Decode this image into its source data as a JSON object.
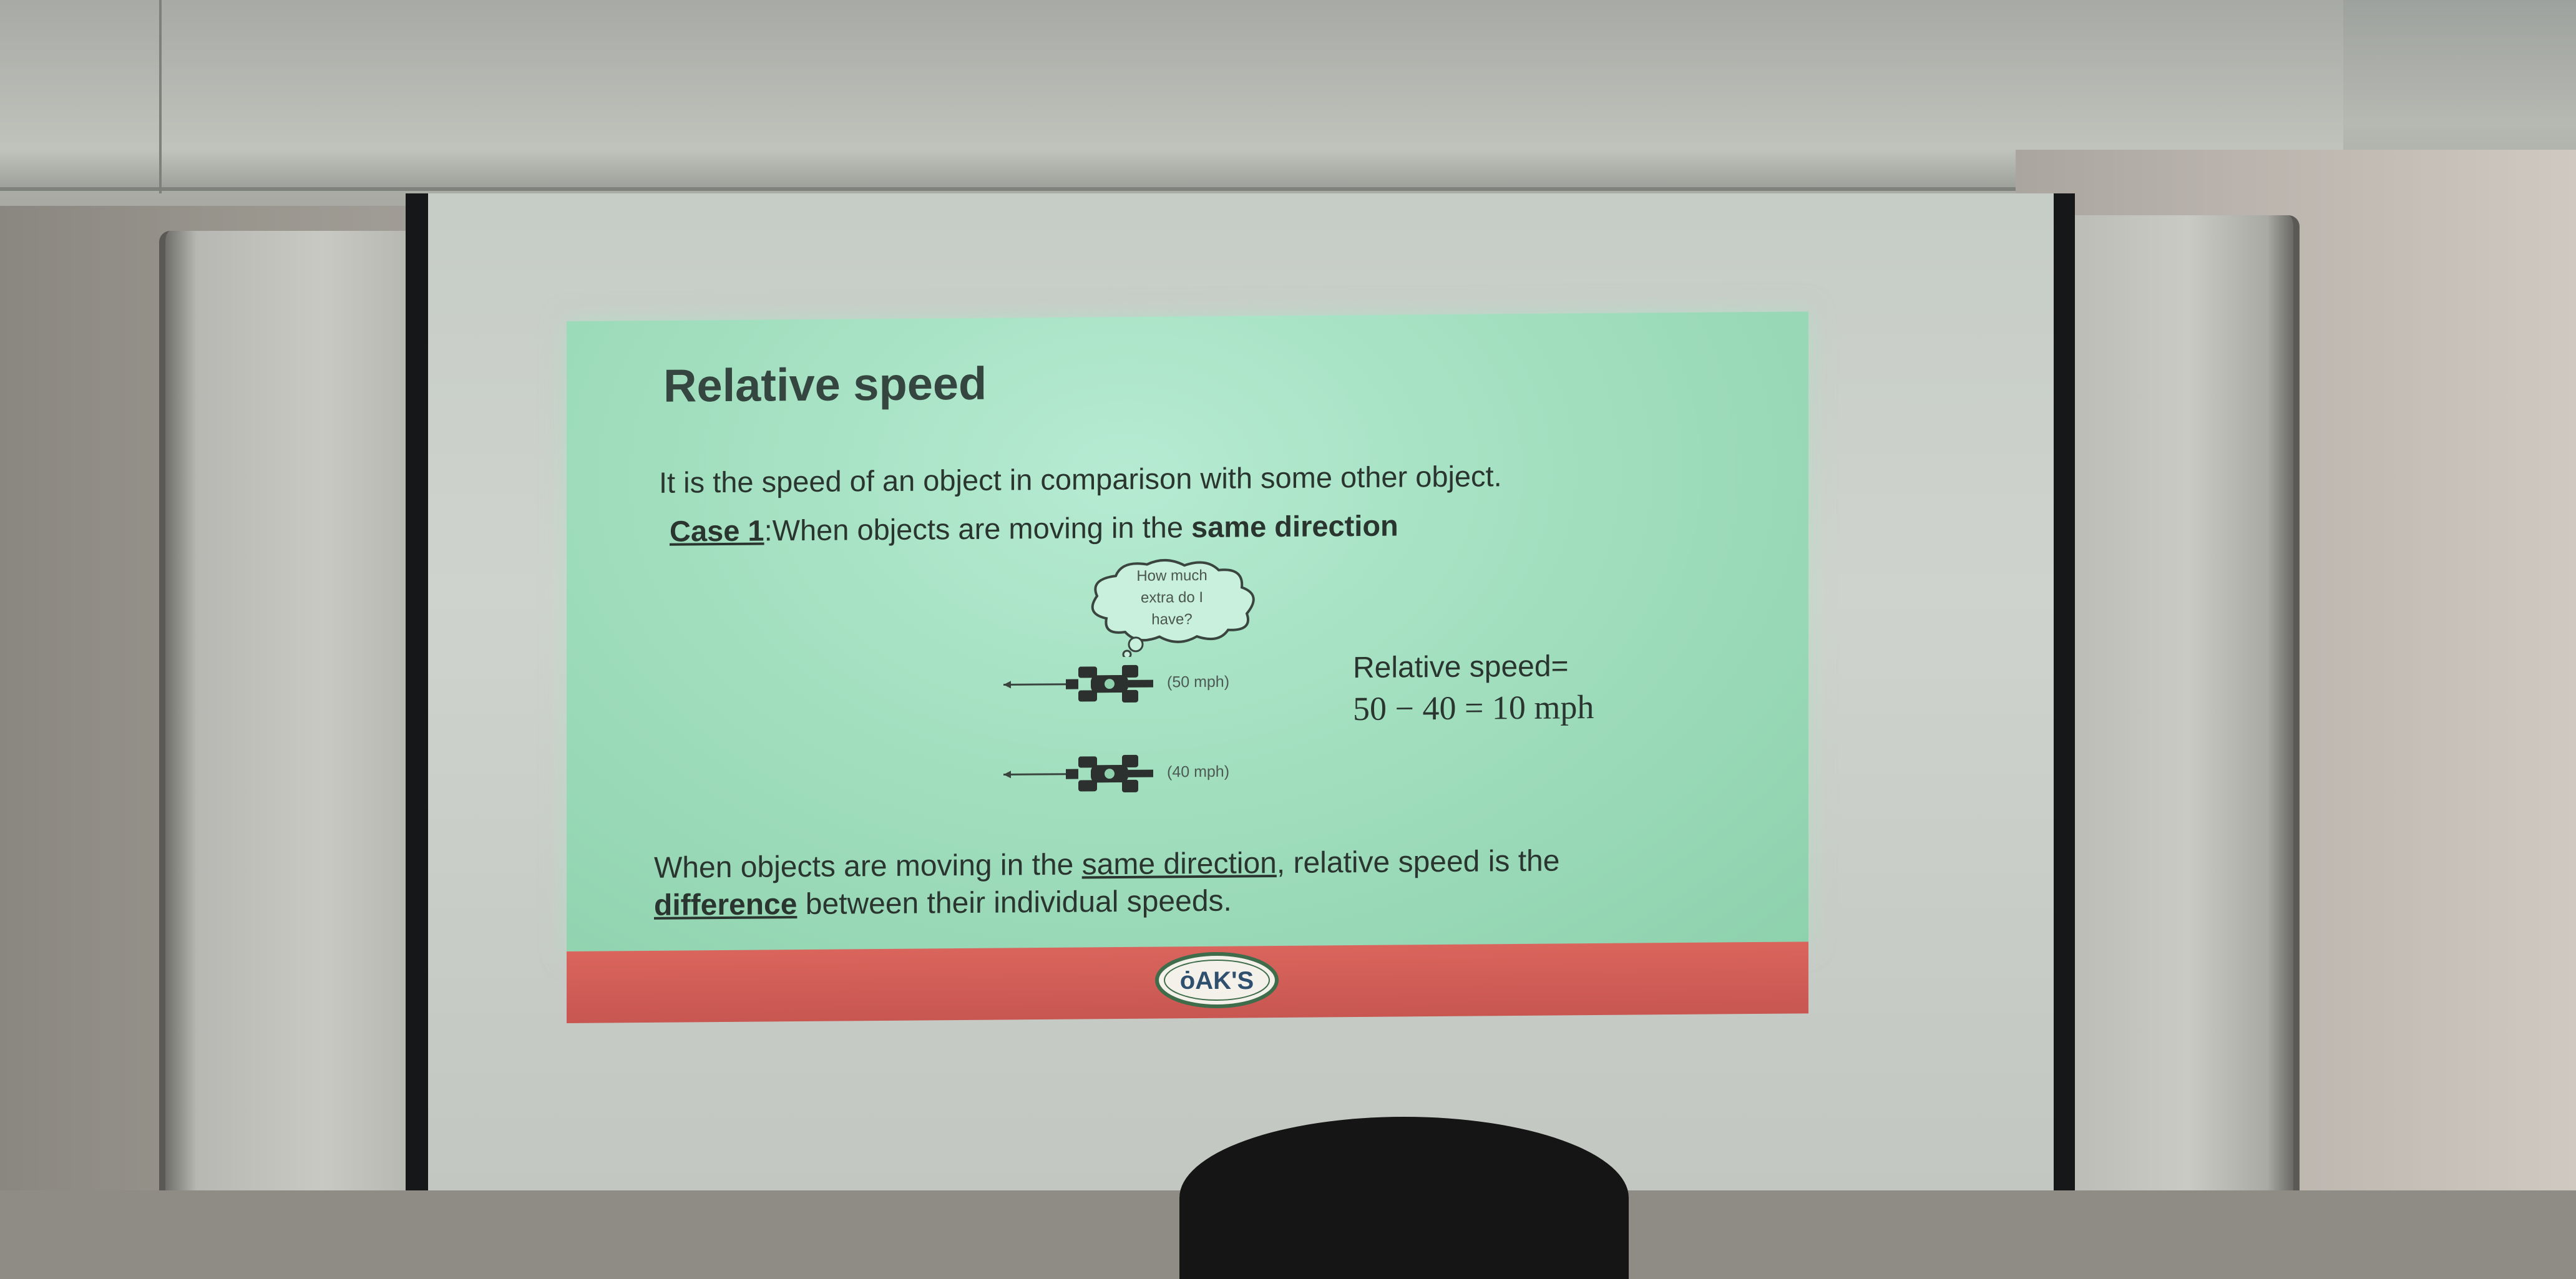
{
  "slide": {
    "title": "Relative speed",
    "definition": "It is the speed of an object in comparison with some other object.",
    "case": {
      "label": "Case 1",
      "text_before": ":When objects are moving in the ",
      "emphasis": "same direction"
    },
    "thought_bubble": {
      "line1": "How much",
      "line2": "extra do I",
      "line3": "have?"
    },
    "cars": [
      {
        "speed_label": "(50 mph)"
      },
      {
        "speed_label": "(40 mph)"
      }
    ],
    "relative_speed_label": "Relative speed=",
    "relative_speed_equation": "50 − 40 = 10 mph",
    "summary": {
      "part1": "When objects are moving in the ",
      "link1": "same direction",
      "part2": ", relative speed is the",
      "link2": "difference",
      "part3": " between their individual speeds."
    },
    "footer_logo_text": "ȯAK'S"
  },
  "colors": {
    "slide_background": "#a2dfbf",
    "footer_bar": "#d9655d",
    "text": "#2b3530"
  }
}
